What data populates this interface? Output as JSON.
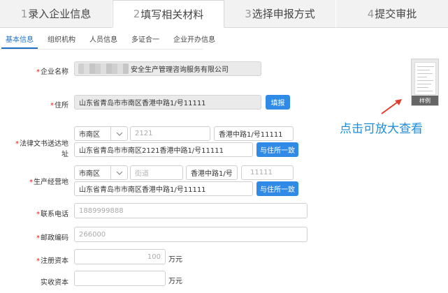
{
  "steps": [
    {
      "num": "1",
      "label": "录入企业信息"
    },
    {
      "num": "2",
      "label": "填写相关材料"
    },
    {
      "num": "3",
      "label": "选择申报方式"
    },
    {
      "num": "4",
      "label": "提交审批"
    }
  ],
  "subtabs": [
    "基本信息",
    "组织机构",
    "人员信息",
    "多证合一",
    "企业开办信息"
  ],
  "form": {
    "company_name": {
      "label": "企业名称",
      "value": "安全生产管理咨询服务有限公司"
    },
    "address": {
      "label": "住所",
      "value": "山东省青岛市市南区香港中路1/号11111",
      "button": "填报"
    },
    "legal_address": {
      "label": "法律文书送达地址",
      "district": "市南区",
      "street_no": "2121",
      "road": "香港中路1/号11111",
      "full": "山东省青岛市市南区2121香港中路1/号11111",
      "button": "与住所一致"
    },
    "biz_address": {
      "label": "生产经营地",
      "district": "市南区",
      "street_placeholder": "街道",
      "road": "香港中路1/号",
      "number": "11111",
      "full": "山东省青岛市市南区香港中路1/号11111",
      "button": "与住所一致"
    },
    "phone": {
      "label": "联系电话",
      "value": "1889999888"
    },
    "postcode": {
      "label": "邮政编码",
      "value": "266000"
    },
    "reg_capital": {
      "label": "注册资本",
      "value": "100",
      "unit": "万元"
    },
    "paid_capital": {
      "label": "实收资本",
      "value": "",
      "unit": "万元"
    }
  },
  "sample": {
    "tag": "样例",
    "hint": "点击可放大查看"
  }
}
